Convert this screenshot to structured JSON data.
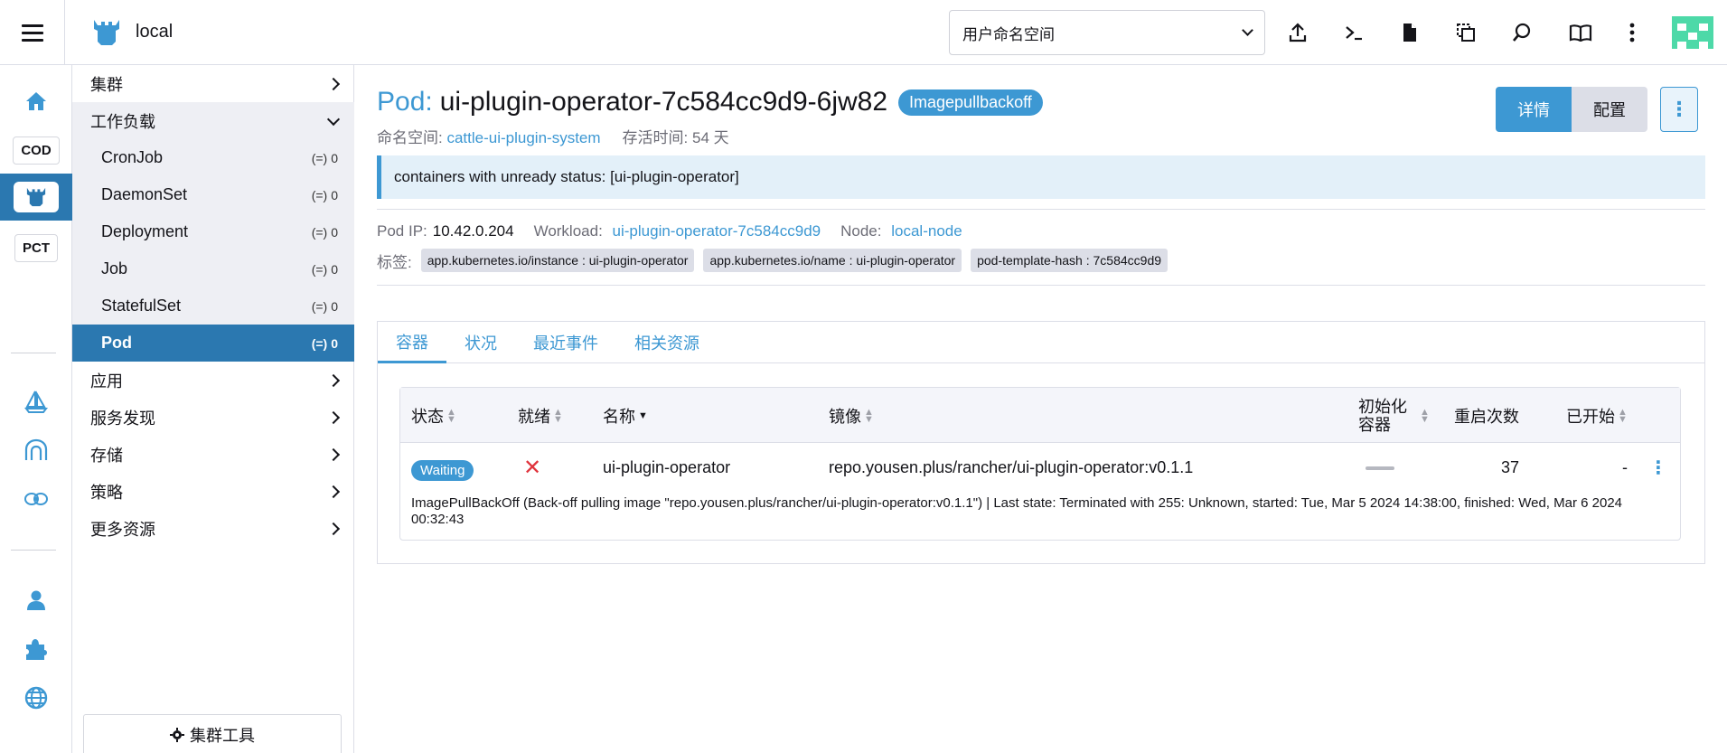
{
  "header": {
    "cluster_name": "local",
    "namespace_select": "用户命名空间"
  },
  "rail": {
    "items": [
      "COD",
      "PCT"
    ]
  },
  "sidenav": {
    "cluster": "集群",
    "workloads": "工作负载",
    "sub_items": [
      {
        "label": "CronJob",
        "count": "0"
      },
      {
        "label": "DaemonSet",
        "count": "0"
      },
      {
        "label": "Deployment",
        "count": "0"
      },
      {
        "label": "Job",
        "count": "0"
      },
      {
        "label": "StatefulSet",
        "count": "0"
      },
      {
        "label": "Pod",
        "count": "0"
      }
    ],
    "apps": "应用",
    "service_discovery": "服务发现",
    "storage": "存储",
    "policy": "策略",
    "more_resources": "更多资源",
    "cluster_tools": "集群工具"
  },
  "pod": {
    "prefix": "Pod:",
    "name": "ui-plugin-operator-7c584cc9d9-6jw82",
    "state": "Imagepullbackoff",
    "namespace_label": "命名空间:",
    "namespace": "cattle-ui-plugin-system",
    "age_label": "存活时间:",
    "age": "54 天",
    "detail_button": "详情",
    "config_button": "配置",
    "banner": "containers with unready status: [ui-plugin-operator]",
    "ip_label": "Pod IP:",
    "ip": "10.42.0.204",
    "workload_label": "Workload:",
    "workload": "ui-plugin-operator-7c584cc9d9",
    "node_label": "Node:",
    "node": "local-node",
    "labels_label": "标签:",
    "labels": [
      "app.kubernetes.io/instance : ui-plugin-operator",
      "app.kubernetes.io/name : ui-plugin-operator",
      "pod-template-hash : 7c584cc9d9"
    ]
  },
  "tabs": [
    "容器",
    "状况",
    "最近事件",
    "相关资源"
  ],
  "table": {
    "columns": {
      "state": "状态",
      "ready": "就绪",
      "name": "名称",
      "image": "镜像",
      "init_line1": "初始化",
      "init_line2": "容器",
      "restarts": "重启次数",
      "started": "已开始"
    },
    "row": {
      "state": "Waiting",
      "ready": "✕",
      "name": "ui-plugin-operator",
      "image": "repo.yousen.plus/rancher/ui-plugin-operator:v0.1.1",
      "restarts": "37",
      "started": "-",
      "message": "ImagePullBackOff (Back-off pulling image \"repo.yousen.plus/rancher/ui-plugin-operator:v0.1.1\") | Last state: Terminated with 255: Unknown, started: Tue, Mar 5 2024 14:38:00, finished: Wed, Mar 6 2024 00:32:43"
    }
  },
  "colors": {
    "accent": "#3d98d3",
    "active_nav": "#2b78b0",
    "error": "#e0343d"
  }
}
